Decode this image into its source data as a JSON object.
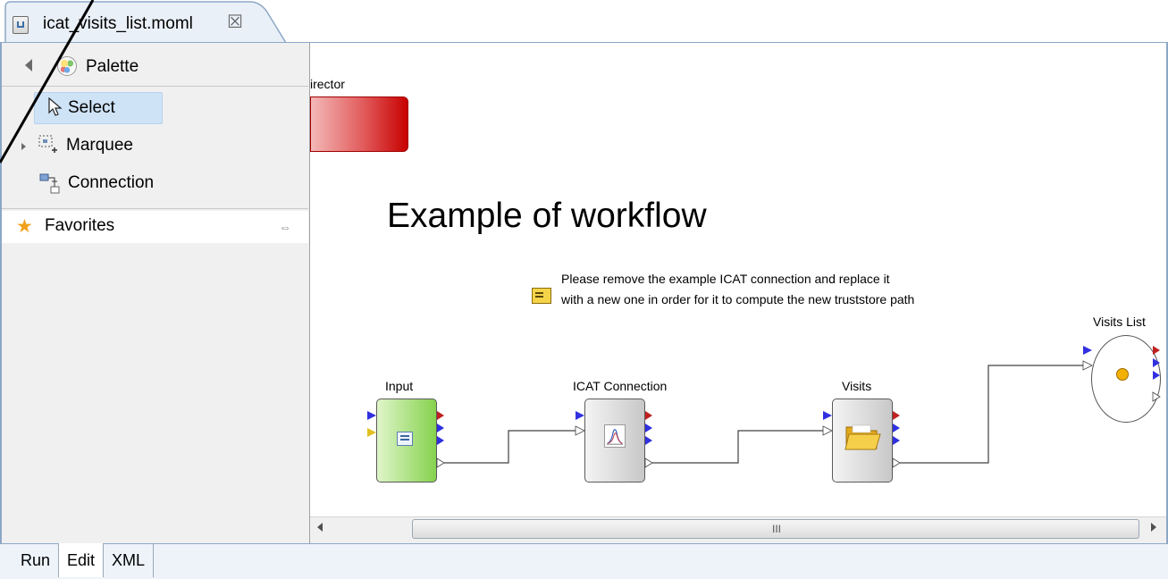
{
  "editor": {
    "tab_title": "icat_visits_list.moml",
    "close_symbol": "☒"
  },
  "palette": {
    "title": "Palette",
    "tools": {
      "select": "Select",
      "marquee": "Marquee",
      "connection": "Connection"
    },
    "favorites": "Favorites",
    "pin_symbol": "⇔",
    "star_symbol": "★"
  },
  "canvas": {
    "director_label": "irector",
    "heading": "Example of workflow",
    "annotation": {
      "line1": "Please remove the example ICAT connection and replace it",
      "line2": "with a new one in order for it to compute the new truststore path"
    },
    "actors": {
      "input": "Input",
      "icat_connection": "ICAT Connection",
      "visits": "Visits",
      "visits_list": "Visits List"
    },
    "port_colors": {
      "input": "#3030e0",
      "output_error": "#c02020",
      "output_data": "#3030e0",
      "trigger": "#e0c020",
      "hollow": "#ffffff"
    }
  },
  "scrollbar": {
    "grip": "III"
  },
  "bottom_tabs": [
    "Run",
    "Edit",
    "XML"
  ],
  "colors": {
    "director": "#cc0000",
    "input_actor": "#86d24e",
    "selection": "#cfe3f7",
    "frame": "#8da8c6"
  }
}
